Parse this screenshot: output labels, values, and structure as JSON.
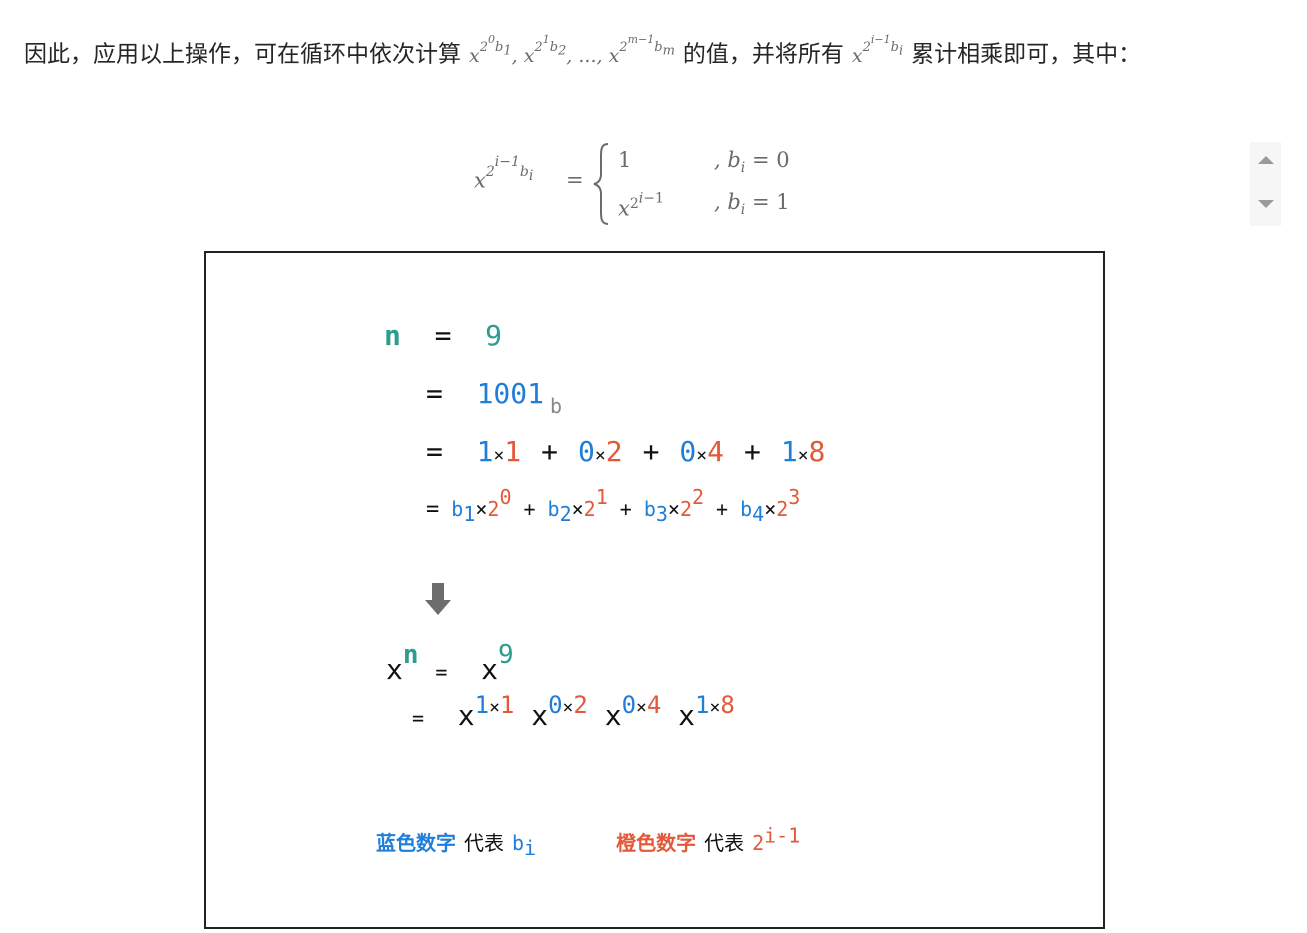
{
  "paragraph": {
    "part1": "因此，应用以上操作，可在循环中依次计算",
    "part2": "的值，并将所有",
    "part3": "累计相乘即可，其中："
  },
  "formula": {
    "case1_value": "1",
    "case1_cond": ", b",
    "case1_cond_rest": " = 0",
    "case2_cond_rest": " = 1"
  },
  "figure": {
    "n_label": "n",
    "eq": "=",
    "n_value": "9",
    "binary": "1001",
    "binary_suffix": "b",
    "expansion": [
      {
        "b": "1",
        "p": "1"
      },
      {
        "b": "0",
        "p": "2"
      },
      {
        "b": "0",
        "p": "4"
      },
      {
        "b": "1",
        "p": "8"
      }
    ],
    "plus": "+",
    "times": "×",
    "b_terms": [
      {
        "sub": "1",
        "exp": "0"
      },
      {
        "sub": "2",
        "exp": "1"
      },
      {
        "sub": "3",
        "exp": "2"
      },
      {
        "sub": "4",
        "exp": "3"
      }
    ],
    "x": "x",
    "base2": "2",
    "arrow_icon": "down-arrow-icon",
    "legend": {
      "blue_label": "蓝色数字",
      "represents": "代表",
      "blue_symbol": "b",
      "blue_sub": "i",
      "orange_label": "橙色数字",
      "orange_symbol": "2",
      "orange_sup": "i-1"
    }
  },
  "colors": {
    "teal": "#2c9c8e",
    "blue": "#1f7ed8",
    "orange": "#e2593a"
  }
}
